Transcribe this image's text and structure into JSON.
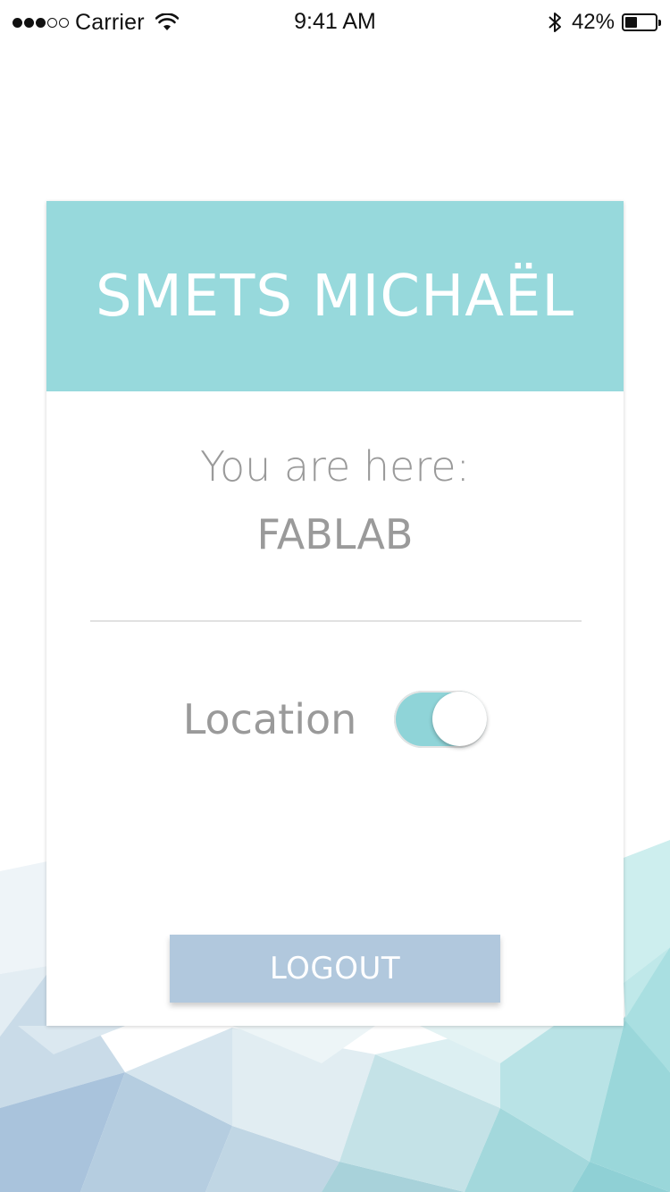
{
  "status_bar": {
    "carrier": "Carrier",
    "time": "9:41 AM",
    "battery_percent": "42%",
    "battery_level": 0.42,
    "signal_bars_filled": 3,
    "signal_bars_total": 5,
    "icons": [
      "wifi-icon",
      "bluetooth-icon",
      "battery-icon"
    ]
  },
  "profile": {
    "name": "SMETS MICHAËL"
  },
  "location_info": {
    "label": "You are here:",
    "place": "FABLAB"
  },
  "location_toggle": {
    "label": "Location",
    "on": true
  },
  "actions": {
    "logout_label": "LOGOUT"
  },
  "colors": {
    "header": "#97d9dc",
    "toggle_on": "#8fd4d8",
    "button": "#b1c8dd",
    "text_gray": "#9a9a9a"
  }
}
